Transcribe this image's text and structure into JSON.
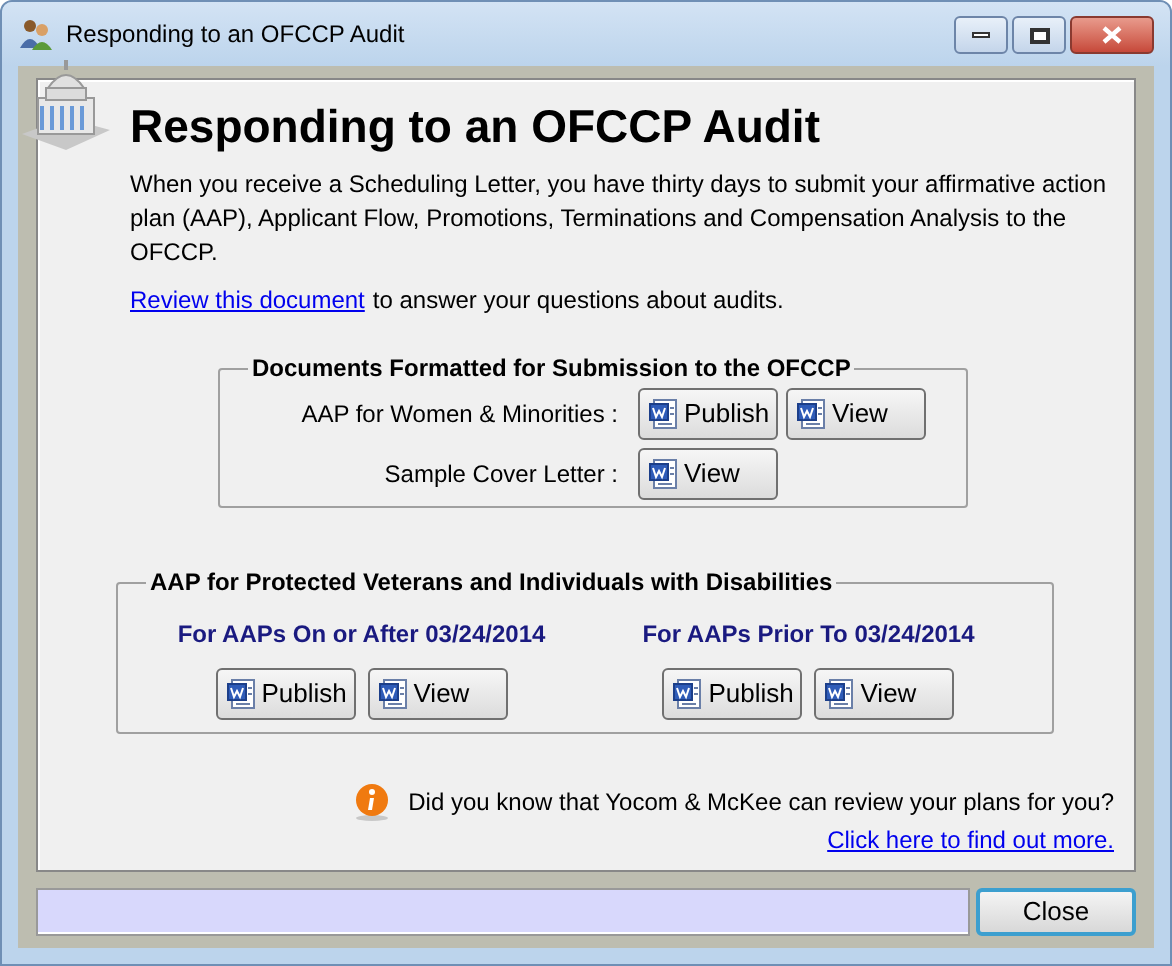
{
  "window": {
    "title": "Responding to an OFCCP Audit"
  },
  "heading": "Responding to an OFCCP Audit",
  "intro": "When you receive a Scheduling Letter, you have thirty days to submit your affirmative action plan (AAP), Applicant Flow, Promotions, Terminations and Compensation Analysis to the OFCCP.",
  "review": {
    "link": "Review this document",
    "text": "to answer your questions about audits."
  },
  "documents_group": {
    "title": "Documents Formatted for Submission to the OFCCP",
    "rows": [
      {
        "label": "AAP for Women & Minorities :",
        "buttons": [
          "Publish",
          "View"
        ]
      },
      {
        "label": "Sample Cover Letter :",
        "buttons": [
          "View"
        ]
      }
    ]
  },
  "veterans_group": {
    "title": "AAP for Protected Veterans and Individuals with Disabilities",
    "columns": [
      {
        "heading": "For AAPs On or After 03/24/2014",
        "buttons": [
          "Publish",
          "View"
        ]
      },
      {
        "heading": "For AAPs Prior To 03/24/2014",
        "buttons": [
          "Publish",
          "View"
        ]
      }
    ]
  },
  "tip": {
    "text": "Did you know that Yocom & McKee can review your plans for you?",
    "link": "Click here to find out more."
  },
  "buttons": [
    "Close"
  ]
}
